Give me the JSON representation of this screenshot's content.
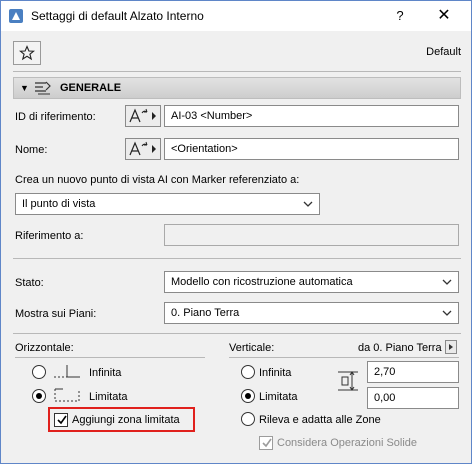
{
  "window": {
    "title": "Settaggi di default Alzato Interno",
    "help_label": "?",
    "close_label": "✕"
  },
  "toolbar": {
    "favorites_icon": "star-icon",
    "default_label": "Default"
  },
  "section": {
    "title": "GENERALE",
    "icon": "elevation-settings-icon"
  },
  "id_field": {
    "label": "ID di riferimento:",
    "value": "AI-03 <Number>",
    "autotext_icon": "autotext-icon"
  },
  "name_field": {
    "label": "Nome:",
    "value": "<Orientation>",
    "autotext_icon": "autotext-icon"
  },
  "viewpoint": {
    "label": "Crea un nuovo punto di vista AI con Marker referenziato a:",
    "selected": "Il punto di vista"
  },
  "reference": {
    "label": "Riferimento a:",
    "value": ""
  },
  "status": {
    "label": "Stato:",
    "selected": "Modello con ricostruzione automatica"
  },
  "show_on_floors": {
    "label": "Mostra sui Piani:",
    "selected": "0. Piano Terra"
  },
  "horizontal": {
    "label": "Orizzontale:",
    "infinite_label": "Infinita",
    "limited_label": "Limitata",
    "add_zone_label": "Aggiungi zona limitata",
    "selected": "Limitata",
    "add_zone_checked": true
  },
  "vertical": {
    "label": "Verticale:",
    "from_floor_label": "da 0. Piano Terra",
    "infinite_label": "Infinita",
    "limited_label": "Limitata",
    "zones_label": "Rileva e adatta alle Zone",
    "solid_ops_label": "Considera Operazioni Solide",
    "selected": "Limitata",
    "top_value": "2,70",
    "bottom_value": "0,00",
    "solid_ops_checked": true
  },
  "colors": {
    "highlight": "#e0201c",
    "window_border": "#5f86c8"
  }
}
